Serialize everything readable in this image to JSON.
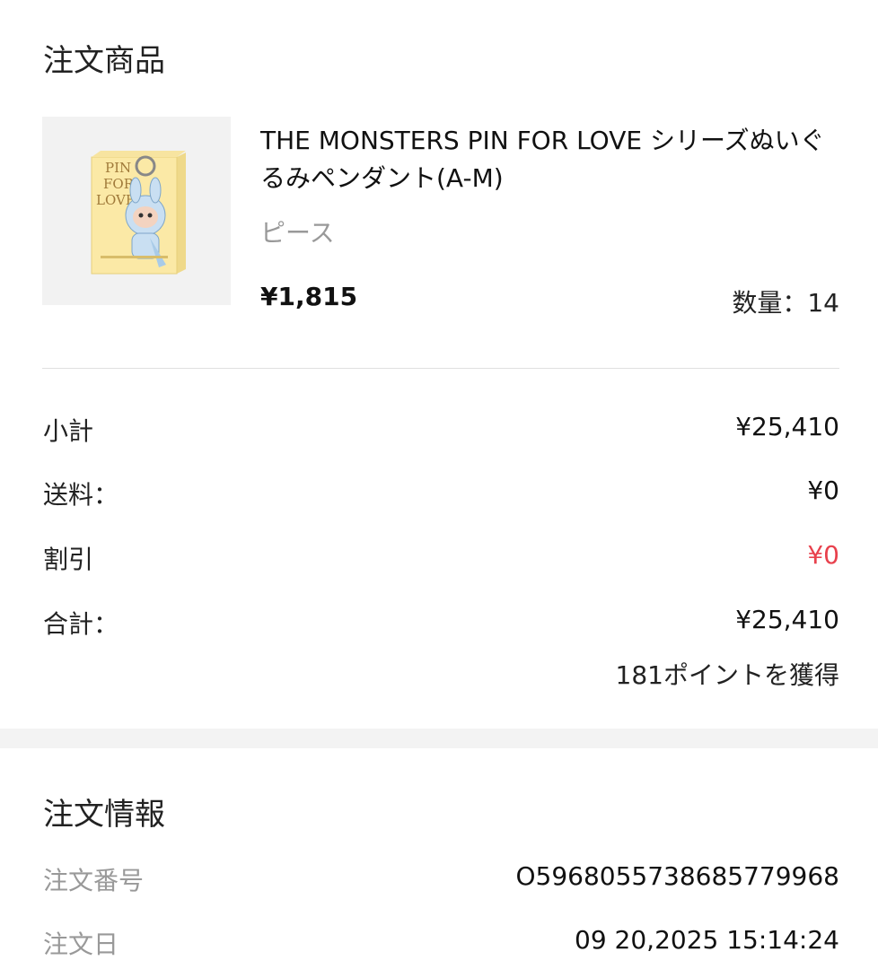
{
  "order_items": {
    "title": "注文商品",
    "product": {
      "name": "THE MONSTERS PIN FOR LOVE シリーズぬいぐるみペンダント(A-M)",
      "variant": "ピース",
      "price": "¥1,815",
      "quantity_label": "数量：14",
      "image": {
        "box_text_line1": "PIN",
        "box_text_line2": "FOR",
        "box_text_line3": "LOVE",
        "box_color": "#fbe9a6",
        "figure_color": "#c9dff2"
      }
    }
  },
  "summary": {
    "subtotal_label": "小計",
    "subtotal_value": "¥25,410",
    "shipping_label": "送料：",
    "shipping_value": "¥0",
    "discount_label": "割引",
    "discount_value": "¥0",
    "total_label": "合計：",
    "total_value": "¥25,410",
    "points": "181ポイントを獲得",
    "discount_color": "#e8414d"
  },
  "order_info": {
    "title": "注文情報",
    "order_number_label": "注文番号",
    "order_number": "O596805573868577996​8",
    "order_date_label": "注文日",
    "order_date": "09 20,2025 15:14:24"
  }
}
